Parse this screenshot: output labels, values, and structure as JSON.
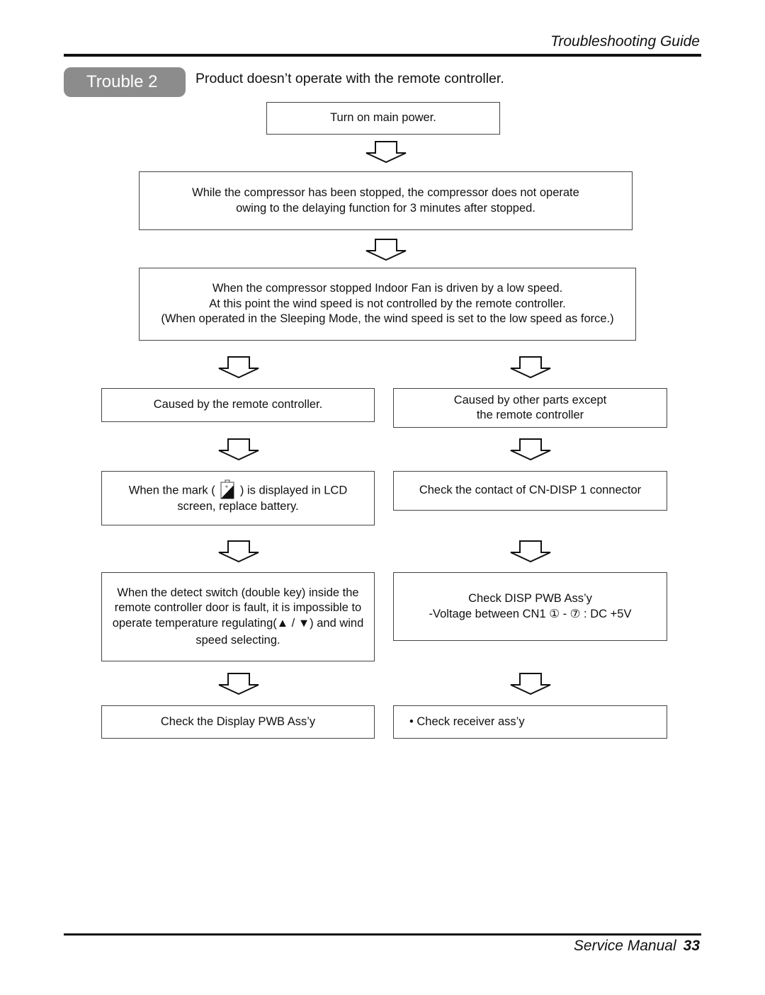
{
  "header": {
    "section_title": "Troubleshooting Guide"
  },
  "trouble": {
    "badge_label": "Trouble 2",
    "title": "Product doesn’t operate with the remote controller."
  },
  "flow": {
    "step1": "Turn on main power.",
    "step2": [
      "While the compressor has been stopped, the compressor does not operate",
      "owing to the delaying function for 3 minutes after stopped."
    ],
    "step3": [
      "When the compressor stopped Indoor Fan is driven by a low speed.",
      "At this point the wind speed is not controlled by the remote controller.",
      "(When operated in the Sleeping Mode, the wind speed is set to the low speed as force.)"
    ],
    "left_branch": {
      "cause": "Caused by the remote controller.",
      "battery_before": "When the mark (",
      "battery_icon": "battery-low-icon",
      "battery_after": ") is displayed in LCD",
      "battery_line2": "screen, replace battery.",
      "detect_switch": [
        "When the detect switch (double key) inside the",
        "remote controller door is fault, it is impossible to",
        "operate temperature regulating(▲ / ▼) and wind",
        "speed selecting."
      ],
      "final": "Check the Display PWB Ass’y"
    },
    "right_branch": {
      "cause": [
        "Caused by other parts except",
        "the remote controller"
      ],
      "connector": "Check the contact of CN-DISP 1 connector",
      "disp_pwb": [
        "Check DISP PWB Ass’y",
        "-Voltage between CN1 ① - ⑦ : DC +5V"
      ],
      "final": "• Check receiver ass’y"
    }
  },
  "footer": {
    "manual_label": "Service Manual",
    "page_number": "33"
  }
}
